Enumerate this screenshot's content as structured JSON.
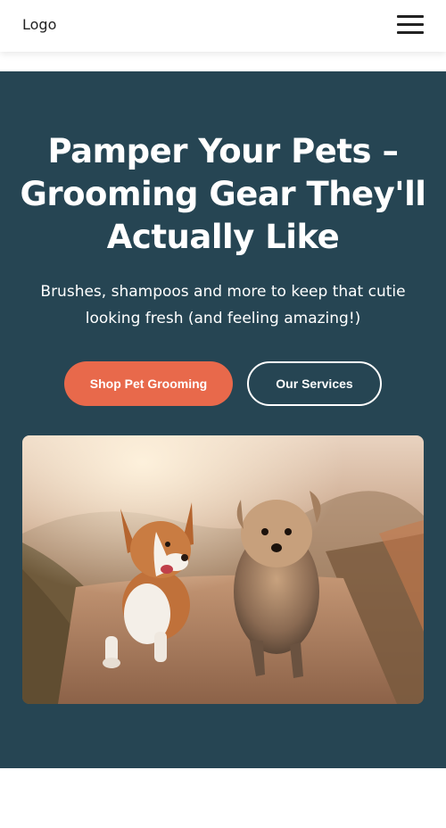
{
  "header": {
    "logo_text": "Logo",
    "menu_icon": "hamburger-menu-icon"
  },
  "hero": {
    "title": "Pamper Your Pets – Grooming Gear They'll Actually Like",
    "subtitle": "Brushes, shampoos and more to keep that cutie looking fresh (and feeling amazing!)",
    "primary_button": "Shop Pet Grooming",
    "secondary_button": "Our Services",
    "image_subject": "corgi and yorkshire terrier running on a dirt path"
  },
  "colors": {
    "hero_background": "#264553",
    "primary_button": "#e8694b",
    "header_background": "#ffffff",
    "text_light": "#ffffff"
  }
}
